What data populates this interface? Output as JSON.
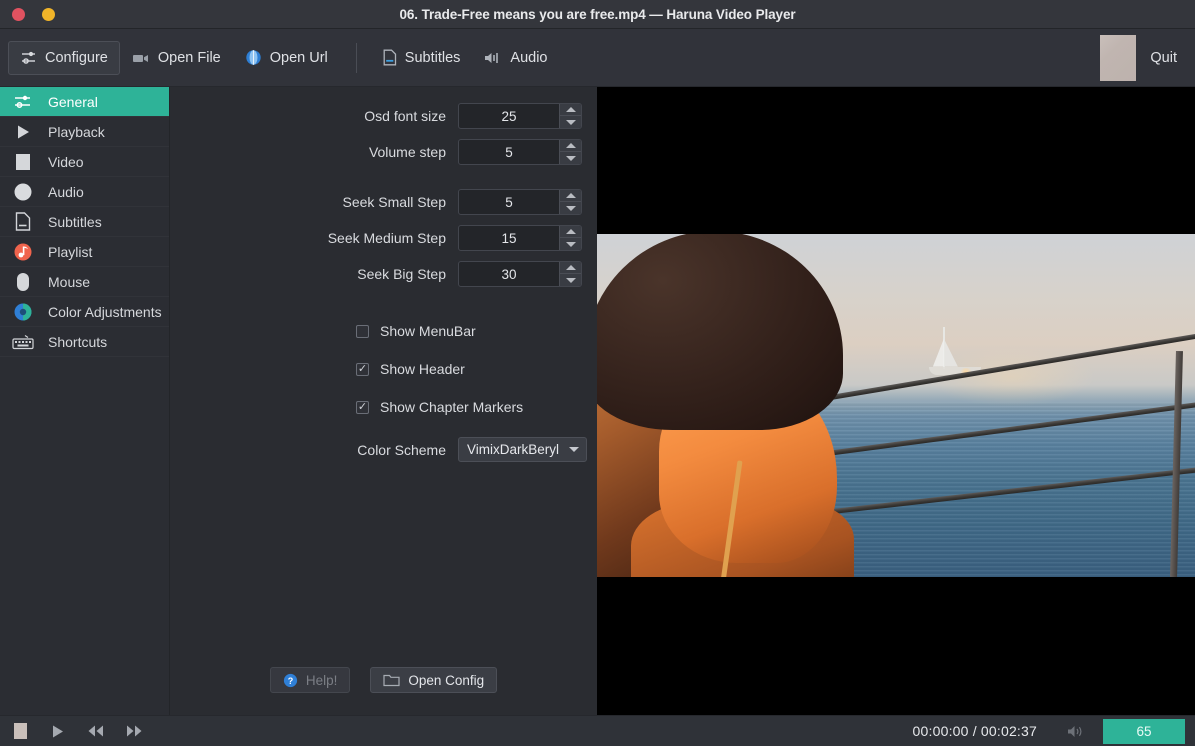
{
  "window": {
    "title": "06. Trade-Free means you are free.mp4 — Haruna Video Player",
    "close_label": "close",
    "minimize_label": "minimize"
  },
  "toolbar": {
    "configure": "Configure",
    "open_file": "Open File",
    "open_url": "Open Url",
    "subtitles": "Subtitles",
    "audio": "Audio",
    "quit": "Quit"
  },
  "sidebar": {
    "items": [
      {
        "label": "General",
        "icon": "sliders-icon",
        "active": true
      },
      {
        "label": "Playback",
        "icon": "play-icon",
        "active": false
      },
      {
        "label": "Video",
        "icon": "video-icon",
        "active": false
      },
      {
        "label": "Audio",
        "icon": "audio-icon",
        "active": false
      },
      {
        "label": "Subtitles",
        "icon": "document-icon",
        "active": false
      },
      {
        "label": "Playlist",
        "icon": "music-note-icon",
        "active": false
      },
      {
        "label": "Mouse",
        "icon": "mouse-icon",
        "active": false
      },
      {
        "label": "Color Adjustments",
        "icon": "color-wheel-icon",
        "active": false
      },
      {
        "label": "Shortcuts",
        "icon": "keyboard-icon",
        "active": false
      }
    ]
  },
  "settings": {
    "spinboxes": [
      {
        "label": "Osd font size",
        "value": "25"
      },
      {
        "label": "Volume step",
        "value": "5"
      },
      {
        "label": "Seek Small Step",
        "value": "5"
      },
      {
        "label": "Seek Medium Step",
        "value": "15"
      },
      {
        "label": "Seek Big Step",
        "value": "30"
      }
    ],
    "checkboxes": [
      {
        "label": "Show MenuBar",
        "checked": false,
        "mark": ""
      },
      {
        "label": "Show Header",
        "checked": true,
        "mark": "✓"
      },
      {
        "label": "Show Chapter Markers",
        "checked": true,
        "mark": "✓"
      }
    ],
    "color_scheme": {
      "label": "Color Scheme",
      "value": "VimixDarkBeryl"
    },
    "buttons": {
      "help": "Help!",
      "open_config": "Open Config"
    }
  },
  "statusbar": {
    "stop": "stop",
    "play": "play",
    "rewind": "rewind",
    "forward": "forward",
    "time": "00:00:00 / 00:02:37",
    "volume": "65",
    "mute_icon": "speaker-icon"
  },
  "colors": {
    "accent": "#2eb398",
    "titlebar": "#34363c",
    "toolbar": "#31333a",
    "panel": "#2a2c31",
    "sidebar": "#2b2d33",
    "close": "#e05260",
    "minimize": "#f0b429"
  }
}
